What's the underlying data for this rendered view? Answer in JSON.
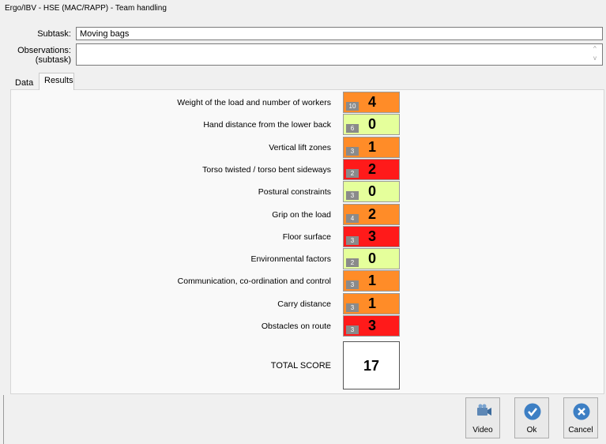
{
  "window": {
    "title": "Ergo/IBV - HSE (MAC/RAPP) - Team handling"
  },
  "form": {
    "subtask_label": "Subtask:",
    "subtask_value": "Moving bags",
    "observations_label_1": "Observations:",
    "observations_label_2": "(subtask)",
    "observations_value": ""
  },
  "tabs": [
    {
      "label": "Data",
      "active": false
    },
    {
      "label": "Results",
      "active": true
    }
  ],
  "colors": {
    "orange": "#ff8c28",
    "green": "#e5ff9b",
    "red": "#ff1a1a"
  },
  "results": [
    {
      "label": "Weight of the load and number of workers",
      "badge": "10",
      "score": "4",
      "color": "orange"
    },
    {
      "label": "Hand distance from the lower back",
      "badge": "6",
      "score": "0",
      "color": "green"
    },
    {
      "label": "Vertical lift zones",
      "badge": "3",
      "score": "1",
      "color": "orange"
    },
    {
      "label": "Torso twisted / torso bent sideways",
      "badge": "2",
      "score": "2",
      "color": "red"
    },
    {
      "label": "Postural constraints",
      "badge": "3",
      "score": "0",
      "color": "green"
    },
    {
      "label": "Grip on the load",
      "badge": "4",
      "score": "2",
      "color": "orange"
    },
    {
      "label": "Floor surface",
      "badge": "3",
      "score": "3",
      "color": "red"
    },
    {
      "label": "Environmental factors",
      "badge": "2",
      "score": "0",
      "color": "green"
    },
    {
      "label": "Communication, co-ordination and control",
      "badge": "3",
      "score": "1",
      "color": "orange"
    },
    {
      "label": "Carry distance",
      "badge": "3",
      "score": "1",
      "color": "orange"
    },
    {
      "label": "Obstacles on route",
      "badge": "3",
      "score": "3",
      "color": "red"
    }
  ],
  "total": {
    "label": "TOTAL SCORE",
    "value": "17"
  },
  "buttons": {
    "video": "Video",
    "ok": "Ok",
    "cancel": "Cancel"
  }
}
